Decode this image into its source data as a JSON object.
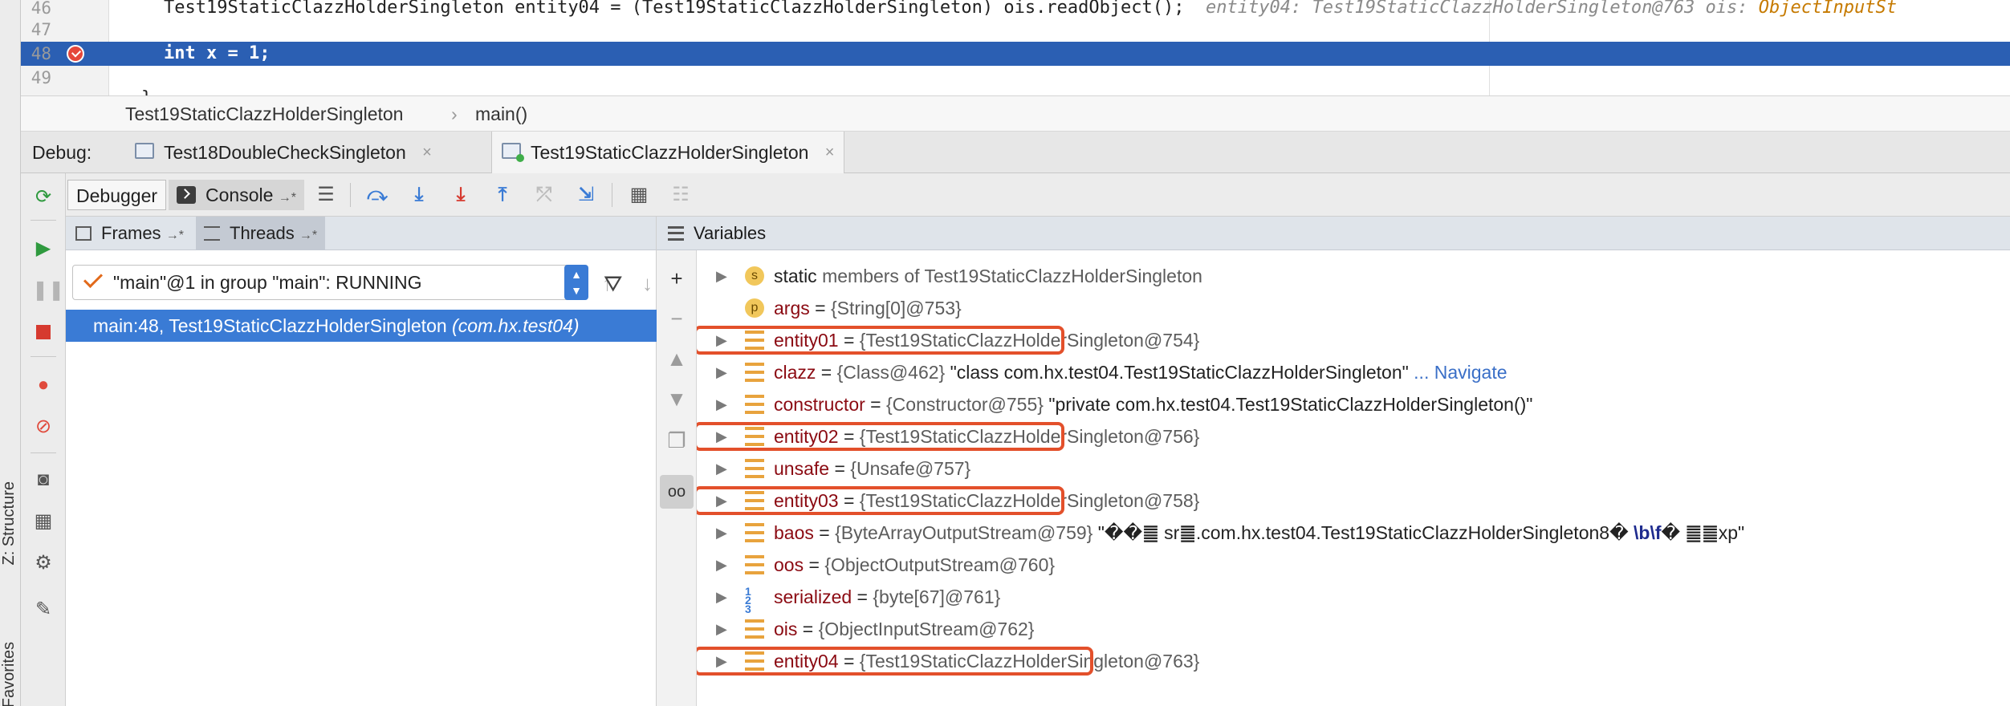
{
  "editor": {
    "lines": [
      {
        "num": "46",
        "code": "Test19StaticClazzHolderSingleton entity04 = (Test19StaticClazzHolderSingleton) ois.readObject();",
        "hint": "entity04: Test19StaticClazzHolderSingleton@763  ois: ",
        "hint_warn": "ObjectInputSt"
      },
      {
        "num": "47",
        "code": ""
      },
      {
        "num": "48",
        "code": "int x = 1;",
        "highlighted": true,
        "breakpoint": true
      },
      {
        "num": "49",
        "code": ""
      }
    ],
    "partial_line": "}",
    "highlight_color": "#2b5fb3"
  },
  "breadcrumb": [
    "Test19StaticClazzHolderSingleton",
    "›",
    "main()"
  ],
  "debug_bar": {
    "label": "Debug:",
    "tabs": [
      {
        "label": "Test18DoubleCheckSingleton",
        "close": "×"
      },
      {
        "label": "Test19StaticClazzHolderSingleton",
        "close": "×"
      }
    ]
  },
  "left_strip": {
    "structure": "Z: Structure",
    "favorites": "Favorites"
  },
  "toolbar": {
    "debugger_tab": "Debugger",
    "console_tab": "Console",
    "pin": "→*",
    "icons": [
      "restore-layout-icon",
      "show-execution-point-icon",
      "step-over-icon",
      "step-into-icon",
      "force-step-into-icon",
      "step-out-icon",
      "drop-frame-icon",
      "run-to-cursor-icon",
      "evaluate-expression-icon",
      "trace-icon"
    ]
  },
  "frames_panel": {
    "frames_tab": "Frames",
    "threads_tab": "Threads",
    "pin": "→*",
    "thread_select": "\"main\"@1 in group \"main\": RUNNING",
    "frame_method": "main:48, Test19StaticClazzHolderSingleton",
    "frame_pkg": "(com.hx.test04)"
  },
  "variables_panel": {
    "title": "Variables",
    "rows": [
      {
        "icon": "s",
        "expander": "▶",
        "name": "static",
        "plain": true,
        "rest": " members of Test19StaticClazzHolderSingleton"
      },
      {
        "icon": "p",
        "expander": "",
        "name": "args",
        "ref": "{String[0]@753}"
      },
      {
        "icon": "field",
        "expander": "▶",
        "name": "entity01",
        "ref": "{Test19StaticClazzHolderSingleton@754}",
        "boxed": true
      },
      {
        "icon": "field",
        "expander": "▶",
        "name": "clazz",
        "ref": "{Class@462}",
        "str": " \"class com.hx.test04.Test19StaticClazzHolderSingleton\"",
        "nav": " ... Navigate"
      },
      {
        "icon": "field",
        "expander": "▶",
        "name": "constructor",
        "ref": "{Constructor@755}",
        "str": " \"private com.hx.test04.Test19StaticClazzHolderSingleton()\""
      },
      {
        "icon": "field",
        "expander": "▶",
        "name": "entity02",
        "ref": "{Test19StaticClazzHolderSingleton@756}",
        "boxed": true
      },
      {
        "icon": "field",
        "expander": "▶",
        "name": "unsafe",
        "ref": "{Unsafe@757}"
      },
      {
        "icon": "field",
        "expander": "▶",
        "name": "entity03",
        "ref": "{Test19StaticClazzHolderSingleton@758}",
        "boxed": true
      },
      {
        "icon": "field",
        "expander": "▶",
        "name": "baos",
        "ref": "{ByteArrayOutputStream@759}",
        "str": " \"��䷀ sr䷀.com.hx.test04.Test19StaticClazzHolderSingleton8� ",
        "esc": "\\b\\f",
        "str2": "�   ䷀䷀xp\""
      },
      {
        "icon": "field",
        "expander": "▶",
        "name": "oos",
        "ref": "{ObjectOutputStream@760}"
      },
      {
        "icon": "arr",
        "expander": "▶",
        "name": "serialized",
        "ref": "{byte[67]@761}"
      },
      {
        "icon": "field",
        "expander": "▶",
        "name": "ois",
        "ref": "{ObjectInputStream@762}"
      },
      {
        "icon": "field",
        "expander": "▶",
        "name": "entity04",
        "ref": "{Test19StaticClazzHolderSingleton@763}",
        "boxed": true
      }
    ],
    "highlight_color": "#e3502b"
  }
}
